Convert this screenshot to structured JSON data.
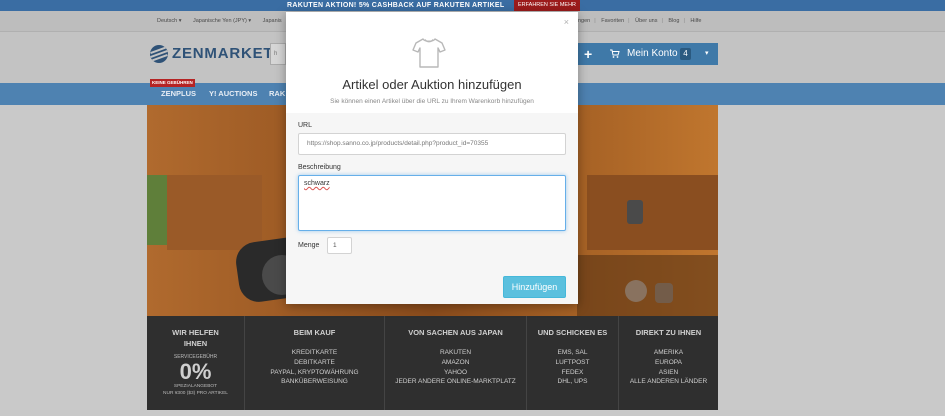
{
  "promo": {
    "text": "RAKUTEN AKTION!   5% CASHBACK AUF RAKUTEN ARTIKEL",
    "cta": "ERFAHREN SIE MEHR"
  },
  "utility_bar": {
    "language": "Deutsch ▾",
    "currency": "Japanische Yen (JPY) ▾",
    "truncated": "Japanis",
    "links": [
      "ngen",
      "Favoriten",
      "Über uns",
      "Blog",
      "Hilfe"
    ]
  },
  "header": {
    "logo_text": "ZENMARKET",
    "search_stub": "h",
    "account_label": "Mein Konto",
    "cart_count": "4",
    "plus": "+",
    "caret": "▾"
  },
  "nav": {
    "badge": "KEINE GEBÜHREN",
    "items": [
      "ZENPLUS",
      "Y! AUCTIONS",
      "RAK"
    ]
  },
  "modal": {
    "close": "×",
    "icon": "tshirt-icon",
    "title": "Artikel oder Auktion hinzufügen",
    "subtitle": "Sie können einen Artikel über die URL zu Ihrem Warenkorb hinzufügen",
    "url_label": "URL",
    "url_value": "https://shop.sanno.co.jp/products/detail.php?product_id=70355",
    "description_label": "Beschreibung",
    "description_value": "schwarz",
    "quantity_label": "Menge",
    "quantity_value": "1",
    "submit_label": "Hinzufügen"
  },
  "footer": {
    "columns": [
      {
        "heading": "WIR HELFEN IHNEN",
        "fee_label": "SERVICEGEBÜHR",
        "fee_value": "0%",
        "fee_note_1": "SPEZIALANGEBOT",
        "fee_note_2": "NUR ¥300 ($3) PRO ARTIKEL"
      },
      {
        "heading": "BEIM KAUF",
        "items": [
          "KREDITKARTE",
          "DEBITKARTE",
          "PAYPAL, KRYPTOWÄHRUNG",
          "BANKÜBERWEISUNG"
        ]
      },
      {
        "heading": "VON SACHEN AUS JAPAN",
        "items": [
          "RAKUTEN",
          "AMAZON",
          "YAHOO",
          "JEDER ANDERE ONLINE-MARKTPLATZ"
        ]
      },
      {
        "heading": "UND SCHICKEN ES",
        "items": [
          "EMS, SAL",
          "LUFTPOST",
          "FEDEX",
          "DHL, UPS"
        ]
      },
      {
        "heading": "DIREKT ZU IHNEN",
        "items": [
          "AMERIKA",
          "EUROPA",
          "ASIEN",
          "ALLE ANDEREN LÄNDER"
        ]
      }
    ]
  },
  "colors": {
    "brand": "#2f5277",
    "nav": "#4e82b1",
    "button": "#5bc0de",
    "footer": "#2f2f2f"
  }
}
